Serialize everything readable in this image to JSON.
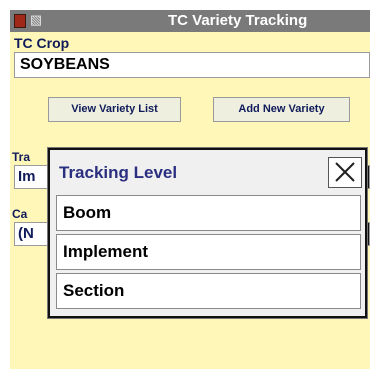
{
  "window": {
    "title": "TC Variety Tracking",
    "icons": [
      "app-icon",
      "tractor-icon"
    ]
  },
  "crop": {
    "label": "TC Crop",
    "value": "SOYBEANS"
  },
  "buttons": {
    "view_variety_list": "View Variety List",
    "add_new_variety": "Add New Variety"
  },
  "tracking_field": {
    "label_partial": "Tra",
    "value_partial": "Im"
  },
  "category_field": {
    "label_partial": "Ca",
    "value_partial": "(N"
  },
  "dialog": {
    "title": "Tracking Level",
    "options": [
      "Boom",
      "Implement",
      "Section"
    ],
    "close_icon": "close-icon"
  },
  "colors": {
    "panel_background": "#fff7b8",
    "title_bar": "#7a7a7a",
    "label_text": "#0f1b5a",
    "dialog_title": "#2a2f80"
  }
}
